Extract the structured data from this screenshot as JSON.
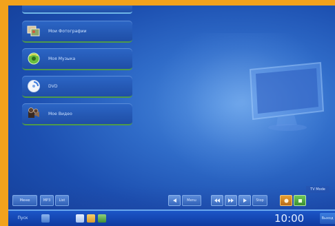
{
  "menu": {
    "items": [
      {
        "label": "Мои Фотографии",
        "icon": "photos-icon"
      },
      {
        "label": "Моя Музыка",
        "icon": "music-icon"
      },
      {
        "label": "DVD",
        "icon": "dvd-icon"
      },
      {
        "label": "Мое Видео",
        "icon": "video-icon"
      }
    ]
  },
  "controls": {
    "left_box": "Меню",
    "small_box_1": "MP3",
    "small_box_2": "List",
    "mid_box": "Menu",
    "right_small": "Stop",
    "corner_label": "TV Mode"
  },
  "taskbar": {
    "start_label": "Пуск",
    "clock": "10:00",
    "right_label": "Выход"
  },
  "colors": {
    "frame": "#f2a21c",
    "accent_green": "#4f9a4a",
    "highlight": "#6aa8ee"
  }
}
